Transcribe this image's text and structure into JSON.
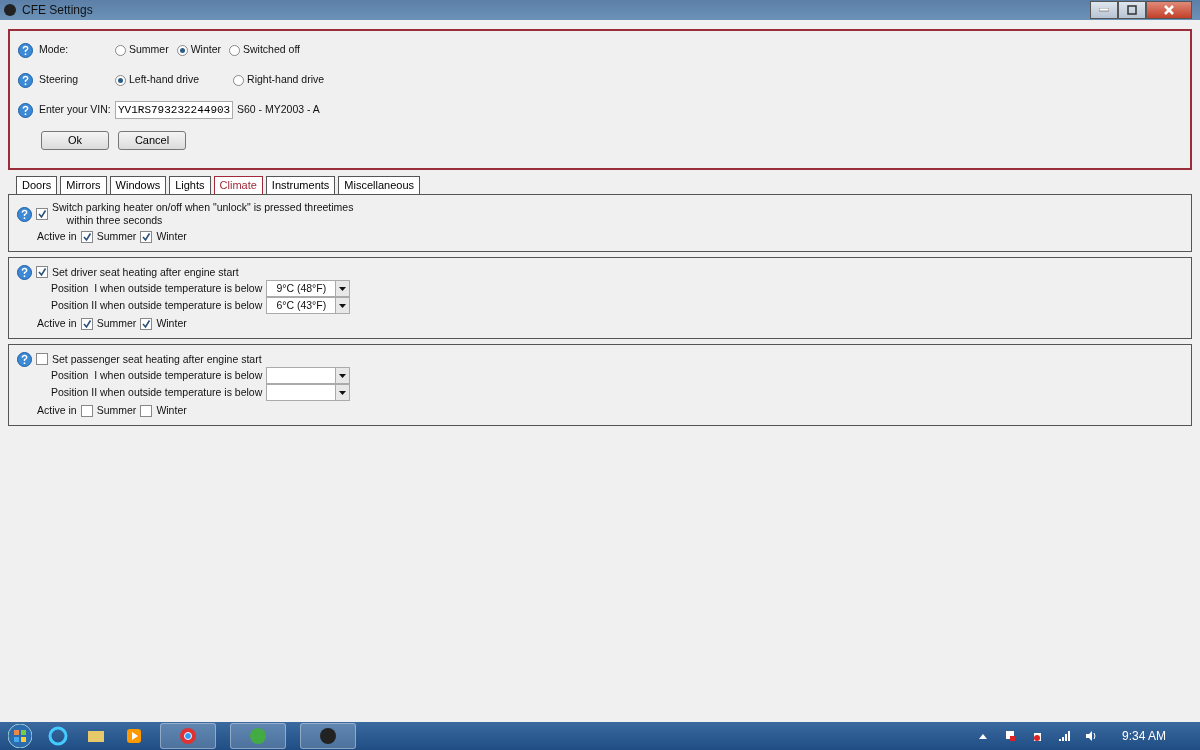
{
  "window": {
    "title": "CFE Settings"
  },
  "mode": {
    "label": "Mode:",
    "options": [
      {
        "label": "Summer",
        "selected": false
      },
      {
        "label": "Winter",
        "selected": true
      },
      {
        "label": "Switched off",
        "selected": false
      }
    ]
  },
  "steering": {
    "label": "Steering",
    "options": [
      {
        "label": "Left-hand drive",
        "selected": true
      },
      {
        "label": "Right-hand drive",
        "selected": false
      }
    ]
  },
  "vin": {
    "label": "Enter your VIN:",
    "value": "YV1RS793232244903",
    "model": "S60 - MY2003 - A"
  },
  "buttons": [
    "Ok",
    "Cancel"
  ],
  "tabs": [
    {
      "label": "Doors",
      "selected": false
    },
    {
      "label": "Mirrors",
      "selected": false
    },
    {
      "label": "Windows",
      "selected": false
    },
    {
      "label": "Lights",
      "selected": false
    },
    {
      "label": "Climate",
      "selected": true
    },
    {
      "label": "Instruments",
      "selected": false
    },
    {
      "label": "Miscellaneous",
      "selected": false
    }
  ],
  "groups": [
    {
      "checked": true,
      "title_lines": [
        "Switch parking heater on/off when \"unlock\" is pressed threetimes",
        "within three seconds"
      ],
      "active_label": "Active in",
      "seasons": [
        {
          "label": "Summer",
          "checked": true
        },
        {
          "label": "Winter",
          "checked": true
        }
      ]
    },
    {
      "checked": true,
      "title_lines": [
        "Set driver seat heating after engine start"
      ],
      "positions": [
        {
          "label": "Position  I when outside temperature is below",
          "value": "9°C (48°F)"
        },
        {
          "label": "Position II when outside temperature is below",
          "value": "6°C (43°F)"
        }
      ],
      "active_label": "Active in",
      "seasons": [
        {
          "label": "Summer",
          "checked": true
        },
        {
          "label": "Winter",
          "checked": true
        }
      ]
    },
    {
      "checked": false,
      "title_lines": [
        "Set passenger seat heating after engine start"
      ],
      "positions": [
        {
          "label": "Position  I when outside temperature is below"
        },
        {
          "label": "Position II when outside temperature is below"
        }
      ],
      "active_label": "Active in",
      "seasons": [
        {
          "label": "Summer",
          "checked": false
        },
        {
          "label": "Winter",
          "checked": false
        }
      ]
    }
  ],
  "taskbar": {
    "clock": "9:34 AM"
  }
}
